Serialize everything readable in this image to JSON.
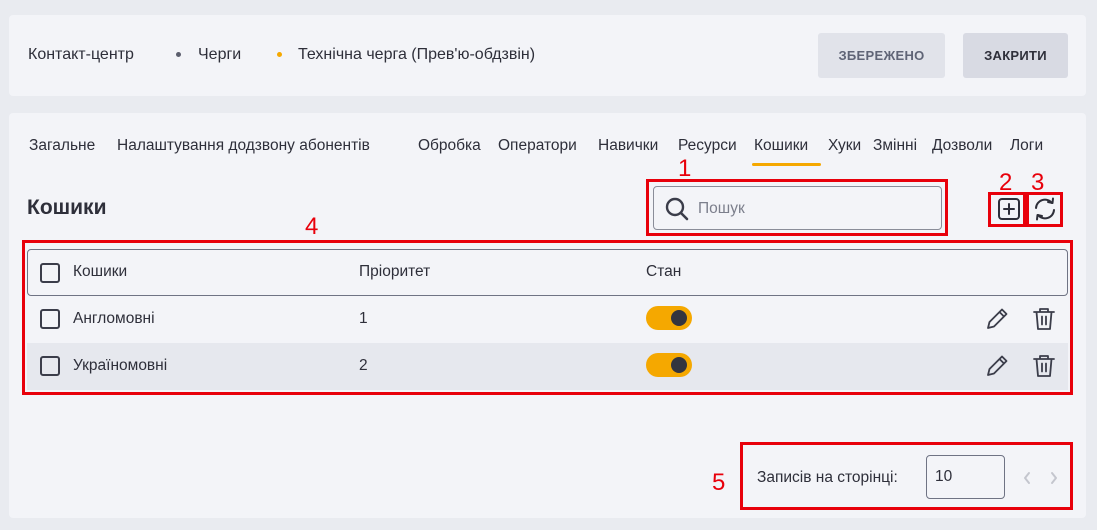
{
  "breadcrumb": {
    "items": [
      "Контакт-центр",
      "Черги",
      "Технічна черга (Прев'ю-обдзвін)"
    ],
    "dot_colors": [
      "#5b5e6d",
      "#f5a800"
    ]
  },
  "header": {
    "saved_label": "ЗБЕРЕЖЕНО",
    "close_label": "ЗАКРИТИ"
  },
  "tabs": {
    "items": [
      "Загальне",
      "Налаштування додзвону абонентів",
      "Обробка",
      "Оператори",
      "Навички",
      "Ресурси",
      "Кошики",
      "Хуки",
      "Змінні",
      "Дозволи",
      "Логи"
    ],
    "active": "Кошики",
    "accent_color": "#f5a800"
  },
  "section": {
    "title": "Кошики"
  },
  "search": {
    "placeholder": "Пошук",
    "value": ""
  },
  "toolbar": {
    "add_icon": "add-square-icon",
    "refresh_icon": "refresh-icon"
  },
  "table": {
    "columns": [
      "Кошики",
      "Пріоритет",
      "Стан"
    ],
    "rows": [
      {
        "name": "Англомовні",
        "priority": "1",
        "enabled": true
      },
      {
        "name": "Україномовні",
        "priority": "2",
        "enabled": true
      }
    ],
    "row_icons": [
      "edit-pencil-icon",
      "trash-icon"
    ]
  },
  "pagination": {
    "label": "Записів на сторінці:",
    "page_size": "10"
  },
  "annotations": {
    "labels": [
      "1",
      "2",
      "3",
      "4",
      "5"
    ],
    "color": "#e8000b"
  }
}
